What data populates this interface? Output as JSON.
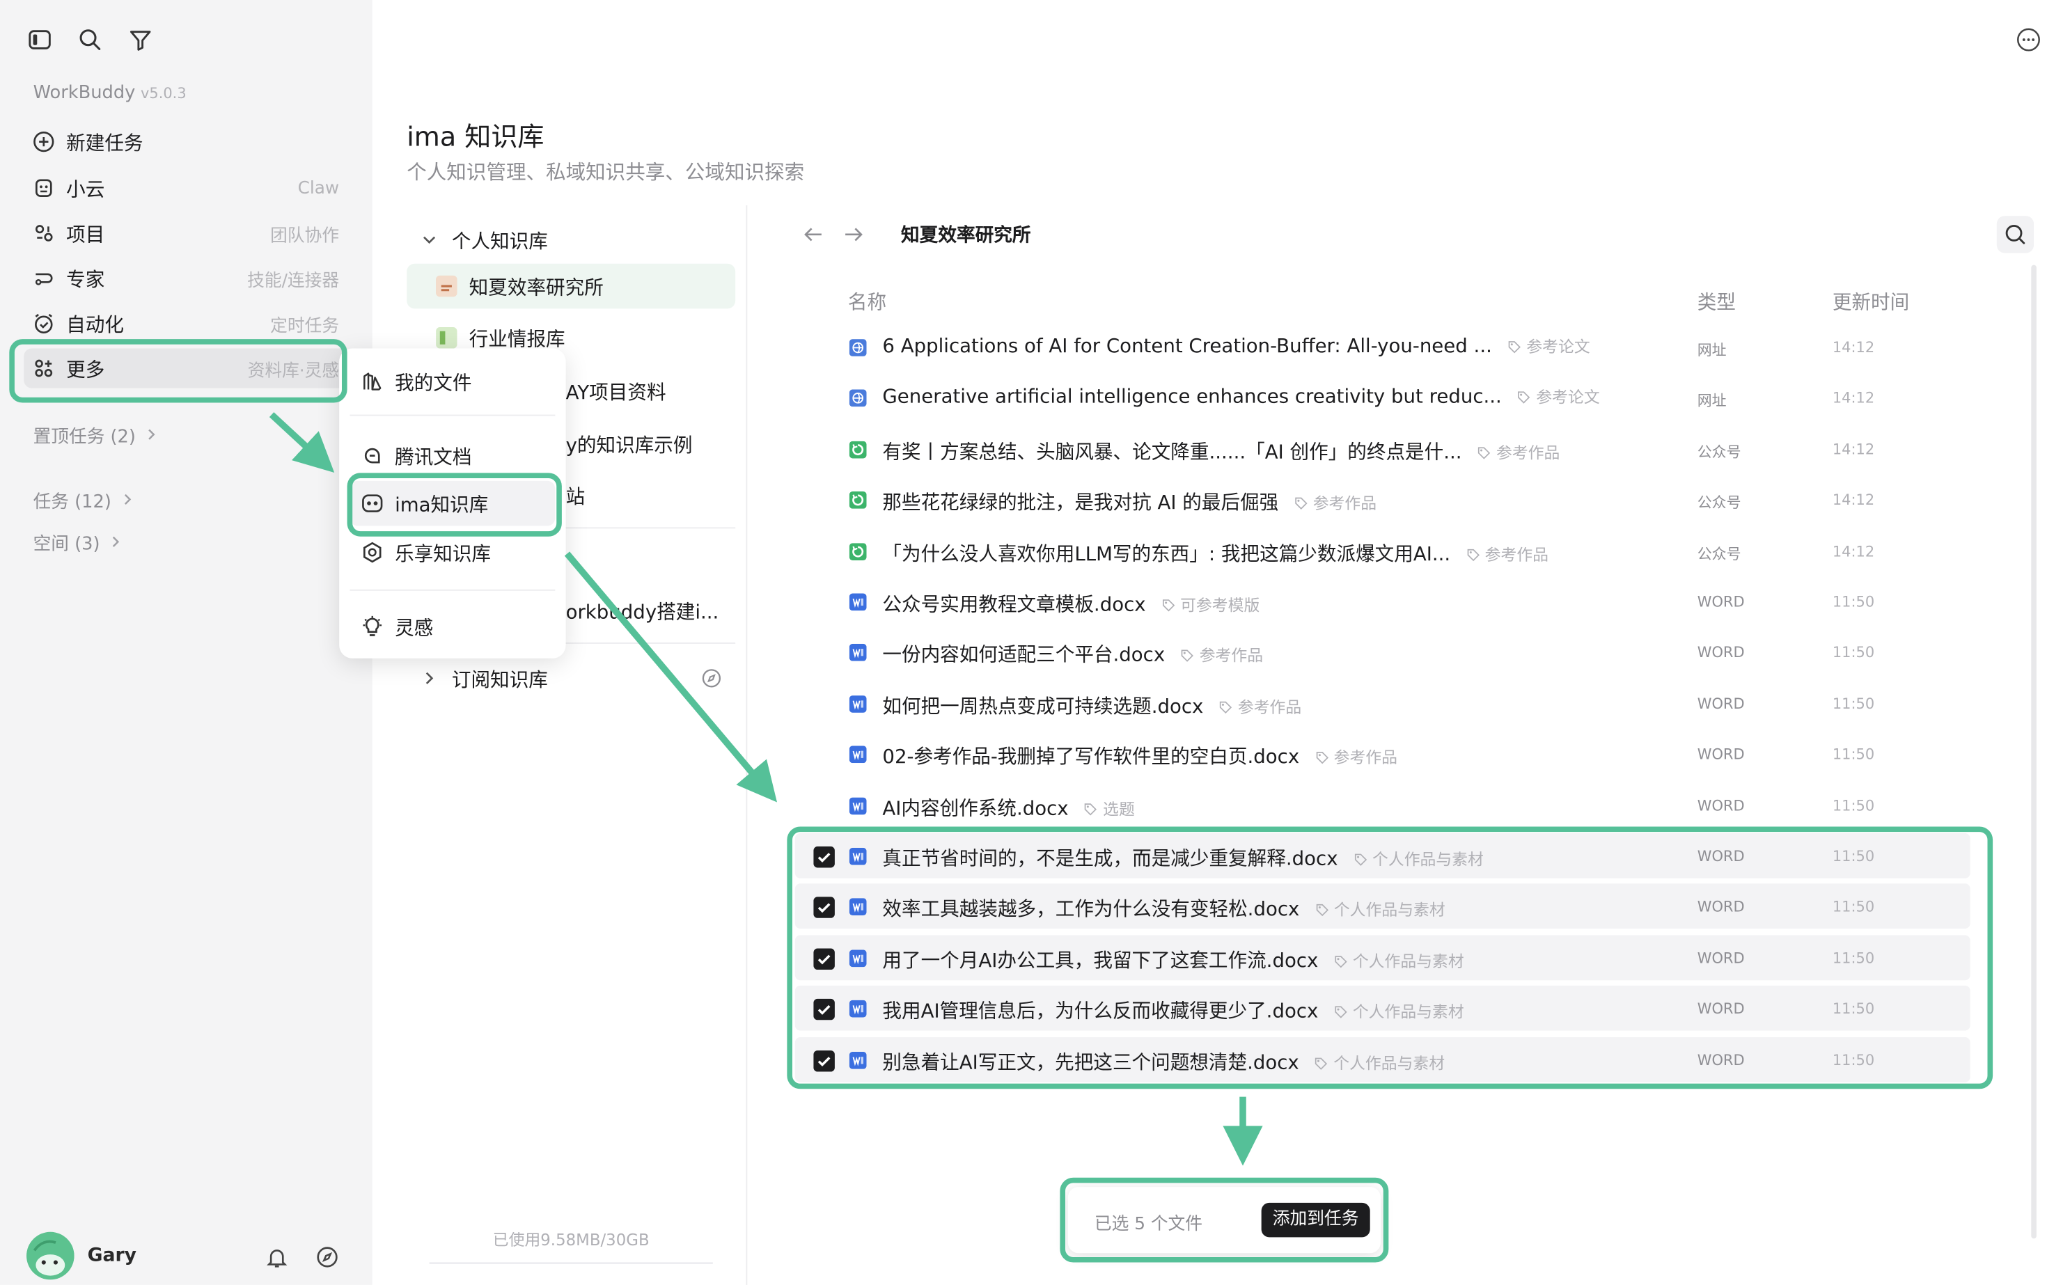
{
  "sidebar": {
    "brand": "WorkBuddy",
    "version": "v5.0.3",
    "items": [
      {
        "label": "新建任务",
        "hint": "",
        "icon": "plus-circle-icon"
      },
      {
        "label": "小云",
        "hint": "Claw",
        "icon": "robot-icon"
      },
      {
        "label": "项目",
        "hint": "团队协作",
        "icon": "project-icon"
      },
      {
        "label": "专家",
        "hint": "技能/连接器",
        "icon": "expert-icon"
      },
      {
        "label": "自动化",
        "hint": "定时任务",
        "icon": "alarm-icon"
      },
      {
        "label": "更多",
        "hint": "资料库·灵感",
        "icon": "grid-plus-icon"
      }
    ],
    "sections": [
      {
        "label": "置顶任务 (2)"
      },
      {
        "label": "任务 (12)"
      },
      {
        "label": "空间 (3)"
      }
    ],
    "user": {
      "name": "Gary"
    }
  },
  "header": {
    "title": "ima 知识库",
    "subtitle": "个人知识管理、私域知识共享、公域知识探索"
  },
  "kb_tree": {
    "personal_label": "个人知识库",
    "items": [
      {
        "label": "知夏效率研究所"
      },
      {
        "label": "行业情报库"
      },
      {
        "label": "AY项目资料"
      },
      {
        "label": "y的知识库示例"
      },
      {
        "label": "站"
      },
      {
        "label": "orkbuddy搭建i..."
      }
    ],
    "subscribed_label": "订阅知识库",
    "storage": "已使用9.58MB/30GB"
  },
  "popup_menu": {
    "items": [
      {
        "label": "我的文件",
        "icon": "files-icon"
      },
      {
        "label": "腾讯文档",
        "icon": "tencent-docs-icon"
      },
      {
        "label": "ima知识库",
        "icon": "ima-icon"
      },
      {
        "label": "乐享知识库",
        "icon": "lexiang-icon"
      },
      {
        "label": "灵感",
        "icon": "lightbulb-icon"
      }
    ]
  },
  "file_panel": {
    "breadcrumb": "知夏效率研究所",
    "columns": {
      "name": "名称",
      "type": "类型",
      "updated": "更新时间"
    },
    "rows": [
      {
        "name": "6 Applications of AI for Content Creation-Buffer: All-you-need ...",
        "tag": "参考论文",
        "type": "网址",
        "time": "14:12",
        "icon": "web",
        "checked": false
      },
      {
        "name": "Generative artificial intelligence enhances creativity but reduc...",
        "tag": "参考论文",
        "type": "网址",
        "time": "14:12",
        "icon": "web",
        "checked": false
      },
      {
        "name": "有奖丨方案总结、头脑风暴、论文降重......「AI 创作」的终点是什...",
        "tag": "参考作品",
        "type": "公众号",
        "time": "14:12",
        "icon": "wechat",
        "checked": false
      },
      {
        "name": "那些花花绿绿的批注，是我对抗 AI 的最后倔强",
        "tag": "参考作品",
        "type": "公众号",
        "time": "14:12",
        "icon": "wechat",
        "checked": false
      },
      {
        "name": "「为什么没人喜欢你用LLM写的东西」: 我把这篇少数派爆文用AI...",
        "tag": "参考作品",
        "type": "公众号",
        "time": "14:12",
        "icon": "wechat",
        "checked": false
      },
      {
        "name": "公众号实用教程文章模板.docx",
        "tag": "可参考模版",
        "type": "WORD",
        "time": "11:50",
        "icon": "word",
        "checked": false
      },
      {
        "name": "一份内容如何适配三个平台.docx",
        "tag": "参考作品",
        "type": "WORD",
        "time": "11:50",
        "icon": "word",
        "checked": false
      },
      {
        "name": "如何把一周热点变成可持续选题.docx",
        "tag": "参考作品",
        "type": "WORD",
        "time": "11:50",
        "icon": "word",
        "checked": false
      },
      {
        "name": "02-参考作品-我删掉了写作软件里的空白页.docx",
        "tag": "参考作品",
        "type": "WORD",
        "time": "11:50",
        "icon": "word",
        "checked": false
      },
      {
        "name": "AI内容创作系统.docx",
        "tag": "选题",
        "type": "WORD",
        "time": "11:50",
        "icon": "word",
        "checked": false
      },
      {
        "name": "真正节省时间的，不是生成，而是减少重复解释.docx",
        "tag": "个人作品与素材",
        "type": "WORD",
        "time": "11:50",
        "icon": "word",
        "checked": true
      },
      {
        "name": "效率工具越装越多，工作为什么没有变轻松.docx",
        "tag": "个人作品与素材",
        "type": "WORD",
        "time": "11:50",
        "icon": "word",
        "checked": true
      },
      {
        "name": "用了一个月AI办公工具，我留下了这套工作流.docx",
        "tag": "个人作品与素材",
        "type": "WORD",
        "time": "11:50",
        "icon": "word",
        "checked": true
      },
      {
        "name": "我用AI管理信息后，为什么反而收藏得更少了.docx",
        "tag": "个人作品与素材",
        "type": "WORD",
        "time": "11:50",
        "icon": "word",
        "checked": true
      },
      {
        "name": "别急着让AI写正文，先把这三个问题想清楚.docx",
        "tag": "个人作品与素材",
        "type": "WORD",
        "time": "11:50",
        "icon": "word",
        "checked": true
      }
    ]
  },
  "selection_bar": {
    "count_text": "已选 5 个文件",
    "action_label": "添加到任务"
  },
  "colors": {
    "accent_green": "#55c098",
    "word_blue": "#3b6fe0",
    "wechat_green": "#3cb46a",
    "web_blue": "#4a7bdc"
  }
}
